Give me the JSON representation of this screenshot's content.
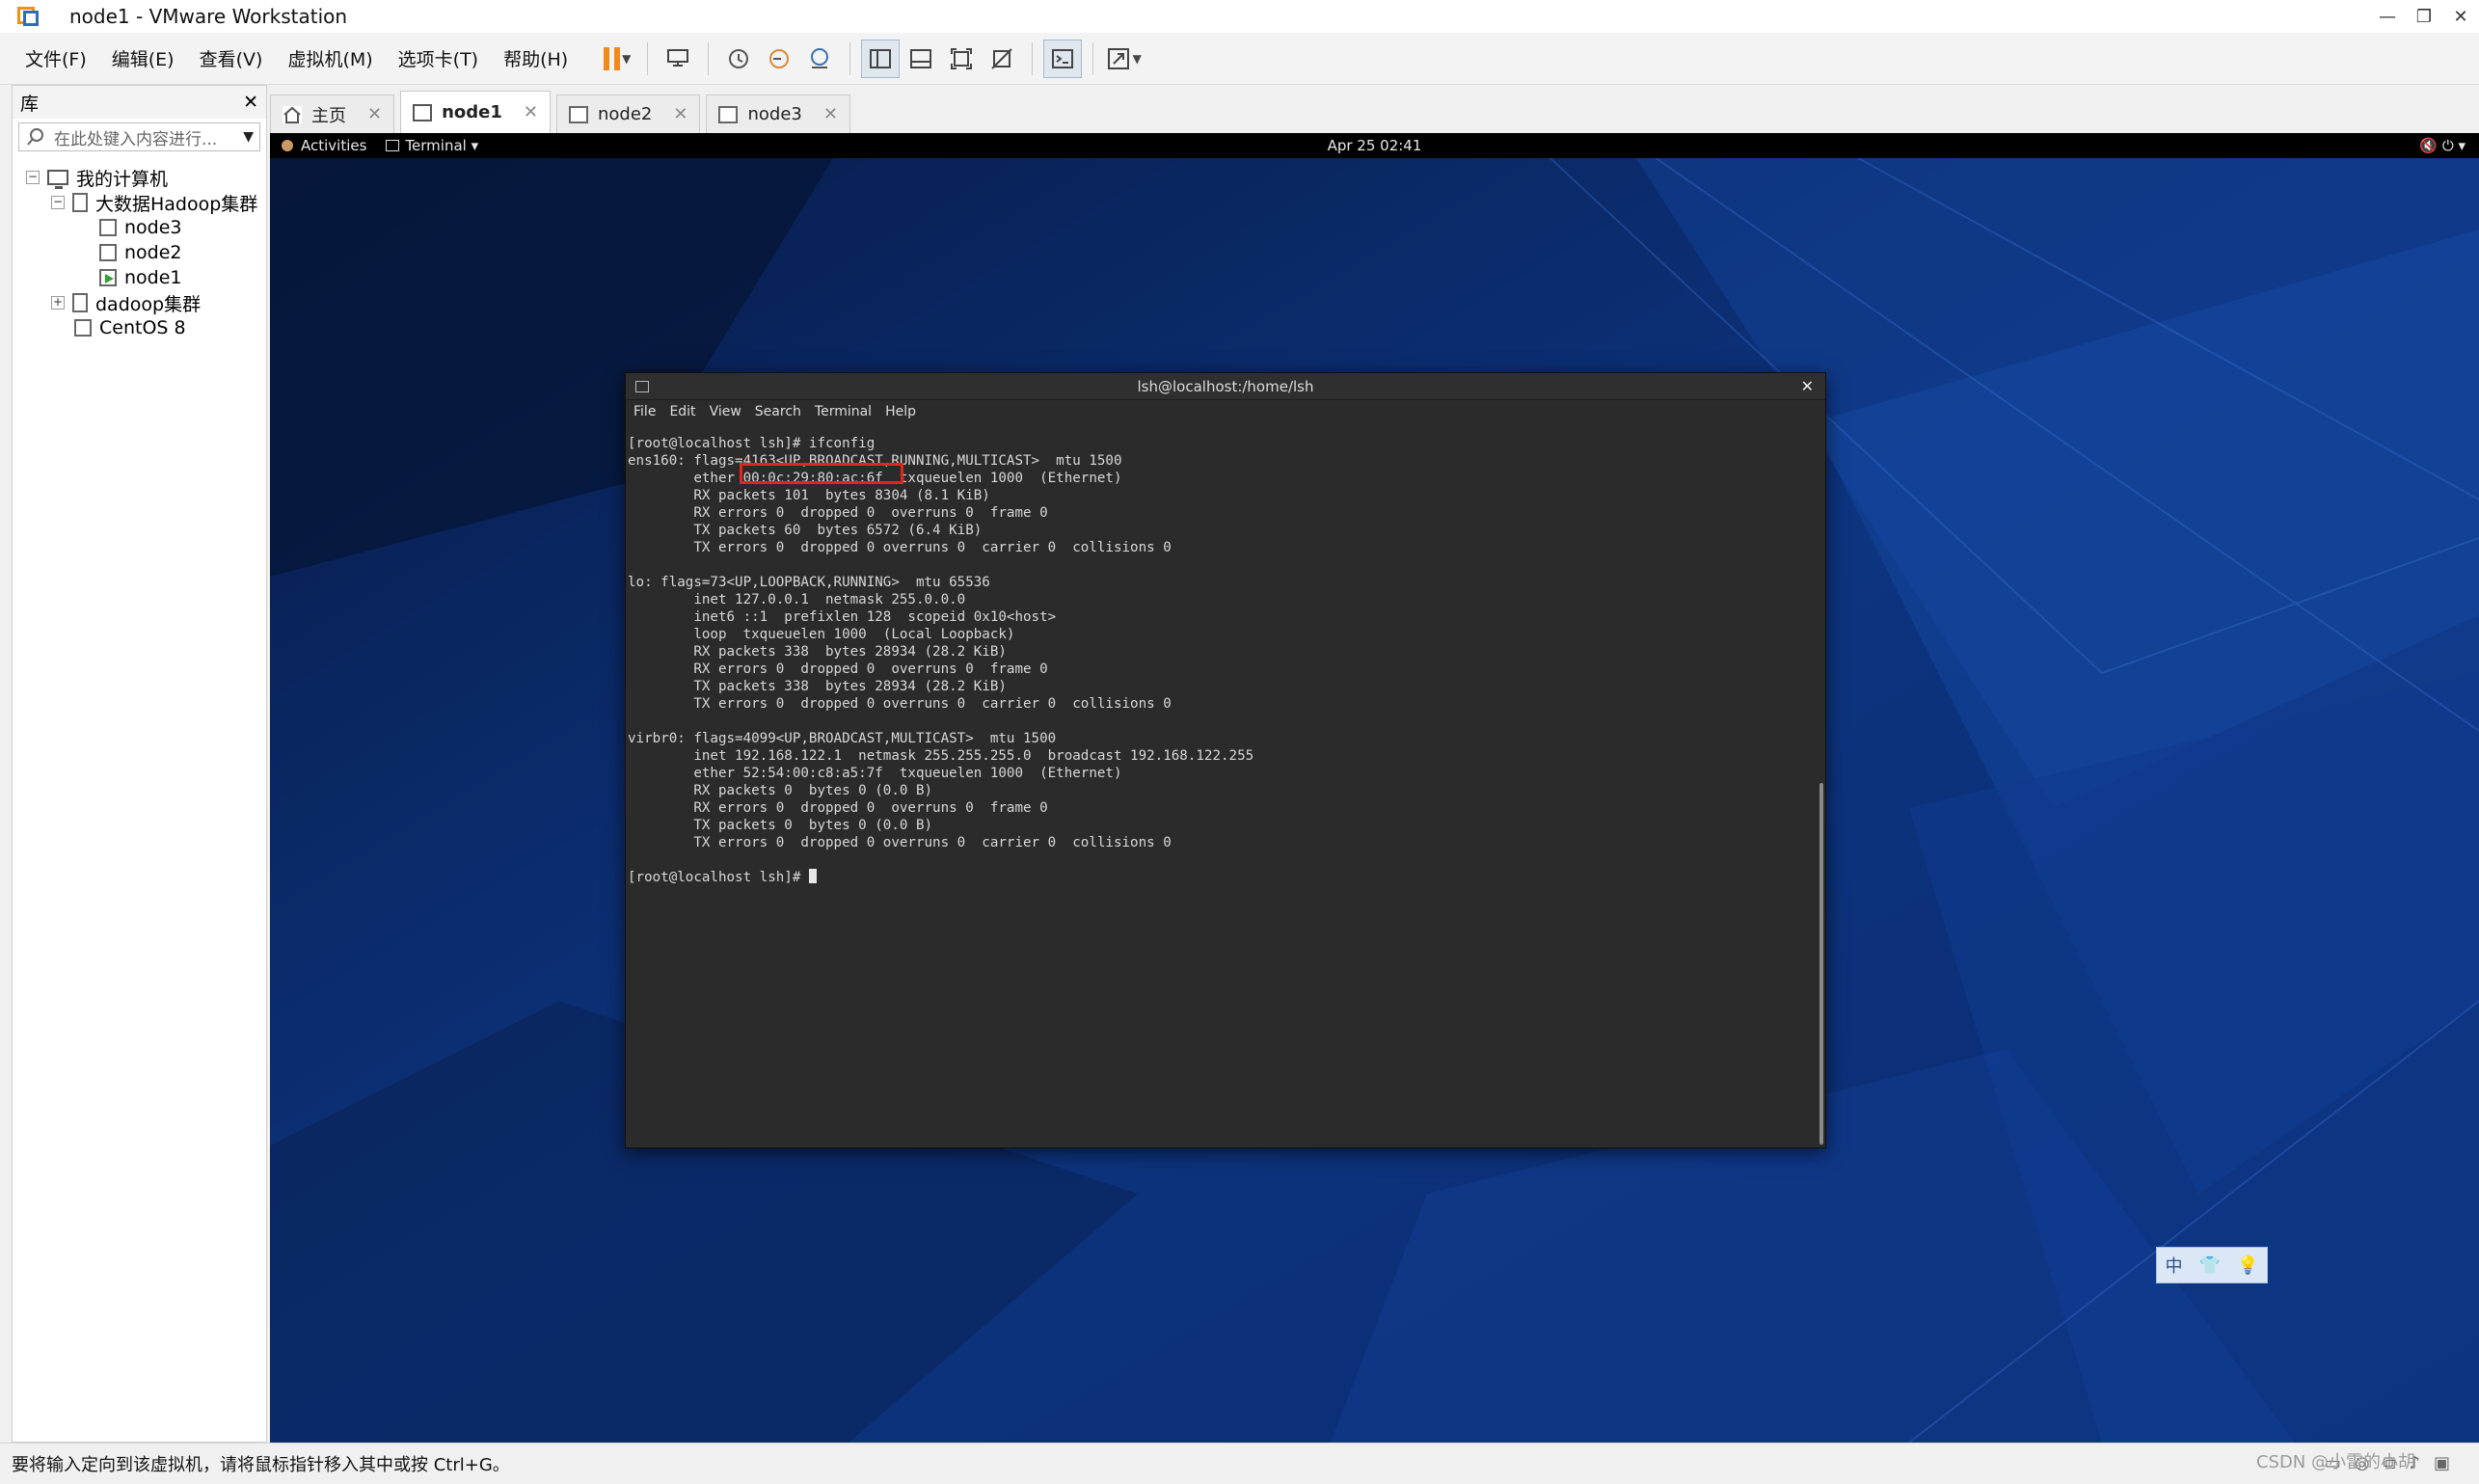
{
  "window": {
    "title": "node1 - VMware Workstation",
    "controls": [
      "—",
      "❐",
      "✕"
    ]
  },
  "menu": [
    "文件(F)",
    "编辑(E)",
    "查看(V)",
    "虚拟机(M)",
    "选项卡(T)",
    "帮助(H)"
  ],
  "library": {
    "title": "库",
    "close": "✕",
    "search_placeholder": "在此处键入内容进行...",
    "tree": {
      "root": "我的计算机",
      "group1": "大数据Hadoop集群",
      "node3": "node3",
      "node2": "node2",
      "node1": "node1",
      "group2": "dadoop集群",
      "centos": "CentOS 8"
    }
  },
  "tabs": [
    {
      "label": "主页"
    },
    {
      "label": "node1"
    },
    {
      "label": "node2"
    },
    {
      "label": "node3"
    }
  ],
  "gnome": {
    "activities": "Activities",
    "terminal_menu": "Terminal ▾",
    "clock": "Apr 25  02:41",
    "tray": "🔇  ⏻  ▾"
  },
  "terminal": {
    "title": "lsh@localhost:/home/lsh",
    "menu": [
      "File",
      "Edit",
      "View",
      "Search",
      "Terminal",
      "Help"
    ],
    "output": "[root@localhost lsh]# ifconfig\nens160: flags=4163<UP,BROADCAST,RUNNING,MULTICAST>  mtu 1500\n        ether 00:0c:29:80:ac:6f  txqueuelen 1000  (Ethernet)\n        RX packets 101  bytes 8304 (8.1 KiB)\n        RX errors 0  dropped 0  overruns 0  frame 0\n        TX packets 60  bytes 6572 (6.4 KiB)\n        TX errors 0  dropped 0 overruns 0  carrier 0  collisions 0\n\nlo: flags=73<UP,LOOPBACK,RUNNING>  mtu 65536\n        inet 127.0.0.1  netmask 255.0.0.0\n        inet6 ::1  prefixlen 128  scopeid 0x10<host>\n        loop  txqueuelen 1000  (Local Loopback)\n        RX packets 338  bytes 28934 (28.2 KiB)\n        RX errors 0  dropped 0  overruns 0  frame 0\n        TX packets 338  bytes 28934 (28.2 KiB)\n        TX errors 0  dropped 0 overruns 0  carrier 0  collisions 0\n\nvirbr0: flags=4099<UP,BROADCAST,MULTICAST>  mtu 1500\n        inet 192.168.122.1  netmask 255.255.255.0  broadcast 192.168.122.255\n        ether 52:54:00:c8:a5:7f  txqueuelen 1000  (Ethernet)\n        RX packets 0  bytes 0 (0.0 B)\n        RX errors 0  dropped 0  overruns 0  frame 0\n        TX packets 0  bytes 0 (0.0 B)\n        TX errors 0  dropped 0 overruns 0  carrier 0  collisions 0\n\n",
    "prompt": "[root@localhost lsh]# "
  },
  "ime": [
    "中",
    "👕",
    "💡"
  ],
  "status": {
    "message": "要将输入定向到该虚拟机，请将鼠标指针移入其中或按 Ctrl+G。",
    "watermark": "CSDN @小雷的小胡"
  },
  "colors": {
    "highlight_box": "#e0261d",
    "vm_background": "#0b2a6a",
    "terminal_bg": "#2b2b2b",
    "pause_accent": "#f08a1b"
  }
}
